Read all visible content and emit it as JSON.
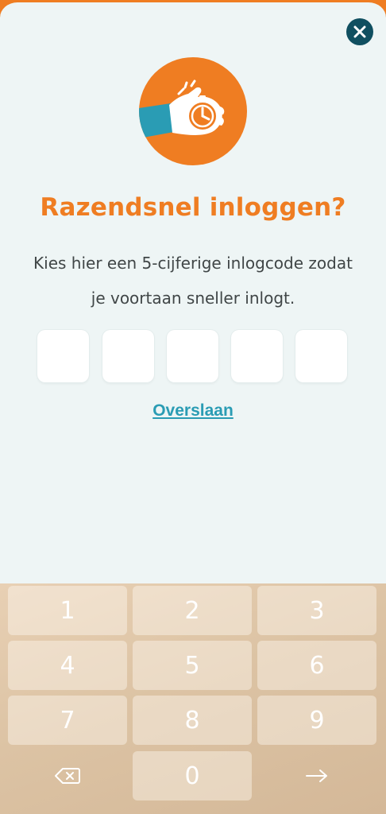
{
  "dialog": {
    "title": "Razendsnel inloggen?",
    "description_line1": "Kies hier een 5-cijferige inlogcode zodat",
    "description_line2": "je voortaan sneller inlogt.",
    "skip_label": "Overslaan",
    "code_length": 5,
    "accent_color": "#ef7d22",
    "link_color": "#2a9cb4",
    "close_button_color": "#104f60"
  },
  "keypad": {
    "rows": [
      [
        "1",
        "2",
        "3"
      ],
      [
        "4",
        "5",
        "6"
      ],
      [
        "7",
        "8",
        "9"
      ]
    ],
    "zero": "0",
    "backspace_icon": "backspace-icon",
    "submit_icon": "arrow-right-icon"
  }
}
